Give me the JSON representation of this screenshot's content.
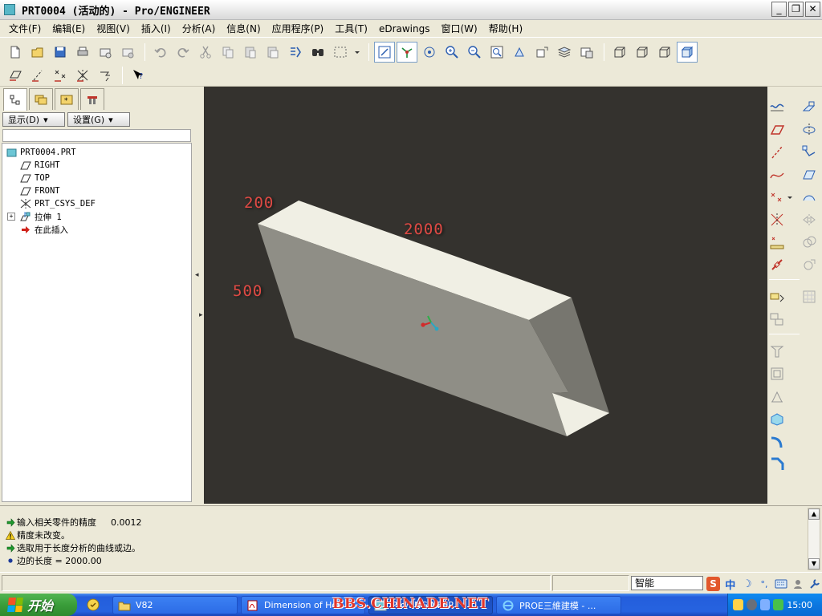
{
  "window": {
    "title": "PRT0004 (活动的) - Pro/ENGINEER",
    "min_label": "_",
    "max_label": "❐",
    "close_label": "✕"
  },
  "menubar": {
    "items": [
      "文件(F)",
      "编辑(E)",
      "视图(V)",
      "插入(I)",
      "分析(A)",
      "信息(N)",
      "应用程序(P)",
      "工具(T)",
      "eDrawings",
      "窗口(W)",
      "帮助(H)"
    ]
  },
  "left_panel": {
    "show_label": "显示(D)",
    "settings_label": "设置(G)",
    "tree": [
      {
        "label": "PRT0004.PRT",
        "icon": "part-icon",
        "indent": 0
      },
      {
        "label": "RIGHT",
        "icon": "datum-plane-icon",
        "indent": 1
      },
      {
        "label": "TOP",
        "icon": "datum-plane-icon",
        "indent": 1
      },
      {
        "label": "FRONT",
        "icon": "datum-plane-icon",
        "indent": 1
      },
      {
        "label": "PRT_CSYS_DEF",
        "icon": "csys-icon",
        "indent": 1
      },
      {
        "label": "拉伸 1",
        "icon": "extrude-icon",
        "indent": 1,
        "expandable": true
      },
      {
        "label": "在此插入",
        "icon": "insert-here-arrow-icon",
        "indent": 1
      }
    ]
  },
  "viewport": {
    "background": "#34322e",
    "dimensions": [
      {
        "value": "200"
      },
      {
        "value": "2000"
      },
      {
        "value": "500"
      }
    ]
  },
  "messages": [
    {
      "icon": "green-arrow-icon",
      "text": "输入相关零件的精度",
      "value": "0.0012"
    },
    {
      "icon": "warning-icon",
      "text": "精度未改变。",
      "value": ""
    },
    {
      "icon": "green-arrow-icon",
      "text": "选取用于长度分析的曲线或边。",
      "value": ""
    },
    {
      "icon": "bullet-icon",
      "text": "边的长度 = 2000.00",
      "value": ""
    }
  ],
  "statusbar": {
    "selection_filter": "智能",
    "ime": {
      "input_mode": "中",
      "half_full": "☽",
      "punct": "°,"
    }
  },
  "taskbar": {
    "start_label": "开始",
    "tasks": [
      {
        "label": "V82",
        "icon": "folder-icon"
      },
      {
        "label": "Dimension of Hou",
        "icon": "pdf-icon"
      },
      {
        "label": "Pro/ENGINEER",
        "icon": "proe-icon",
        "active": true
      },
      {
        "label": "PROE三維建模 - ...",
        "icon": "ie-icon"
      }
    ],
    "watermark": "BBS.CHINADE.NET",
    "clock": "15:00"
  }
}
